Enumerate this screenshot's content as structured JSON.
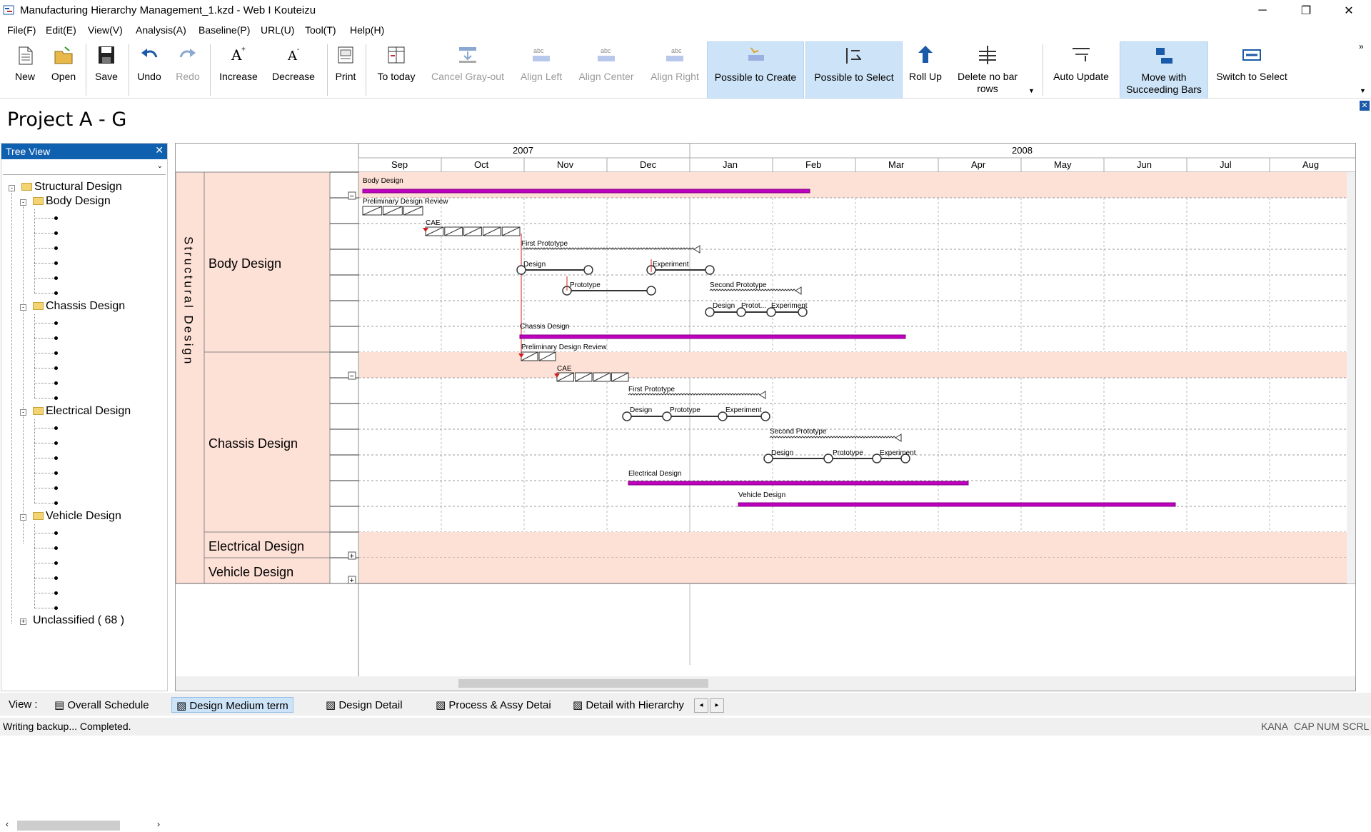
{
  "window": {
    "title": "Manufacturing Hierarchy Management_1.kzd - Web I Kouteizu",
    "minimize": "─",
    "maximize": "❐",
    "close": "✕"
  },
  "menu": [
    "File(F)",
    "Edit(E)",
    "View(V)",
    "Analysis(A)",
    "Baseline(P)",
    "URL(U)",
    "Tool(T)",
    "Help(H)"
  ],
  "toolbar": {
    "new": "New",
    "open": "Open",
    "save": "Save",
    "undo": "Undo",
    "redo": "Redo",
    "increase": "Increase",
    "decrease": "Decrease",
    "print": "Print",
    "to_today": "To today",
    "cancel_grayout": "Cancel Gray-out",
    "align_left": "Align Left",
    "align_center": "Align Center",
    "align_right": "Align Right",
    "possible_create": "Possible to Create",
    "possible_select": "Possible to Select",
    "roll_up": "Roll Up",
    "delete_no_bar": "Delete no bar rows",
    "auto_update": "Auto Update",
    "move_succeeding": "Move with Succeeding Bars",
    "switch_select": "Switch to Select",
    "abc": "abc"
  },
  "project_title": "Project A - G",
  "tree": {
    "header": "Tree View",
    "close": "✕",
    "items": [
      "Structural Design",
      "Body Design",
      "Chassis Design",
      "Electrical Design",
      "Vehicle Design",
      "Unclassified ( 68 )"
    ]
  },
  "timeline": {
    "years": [
      "2007",
      "2008"
    ],
    "months": [
      "Sep",
      "Oct",
      "Nov",
      "Dec",
      "Jan",
      "Feb",
      "Mar",
      "Apr",
      "May",
      "Jun",
      "Jul",
      "Aug"
    ]
  },
  "groups": {
    "level1": "Structural Design",
    "rows": [
      "Body Design",
      "Chassis Design",
      "Electrical Design",
      "Vehicle Design"
    ]
  },
  "bars": {
    "body": "Body Design",
    "pdr": "Preliminary Design Review",
    "cae": "CAE",
    "fp": "First Prototype",
    "design": "Design",
    "experiment": "Experiment",
    "prototype": "Prototype",
    "sp": "Second Prototype",
    "protot": "Protot...",
    "chassis": "Chassis Design",
    "electrical": "Electrical Design",
    "vehicle": "Vehicle Design"
  },
  "view_tabs": {
    "label": "View :",
    "tabs": [
      "Overall Schedule",
      "Design Medium term",
      "Design Detail",
      "Process & Assy Detai",
      "Detail with Hierarchy"
    ]
  },
  "status": {
    "left": "Writing backup... Completed.",
    "indicators": [
      "KANA",
      "CAP",
      "NUM",
      "SCRL"
    ]
  },
  "colors": {
    "accent": "#1060b0",
    "summary_bar": "#c000c0",
    "row_bg": "#fde0d6"
  }
}
